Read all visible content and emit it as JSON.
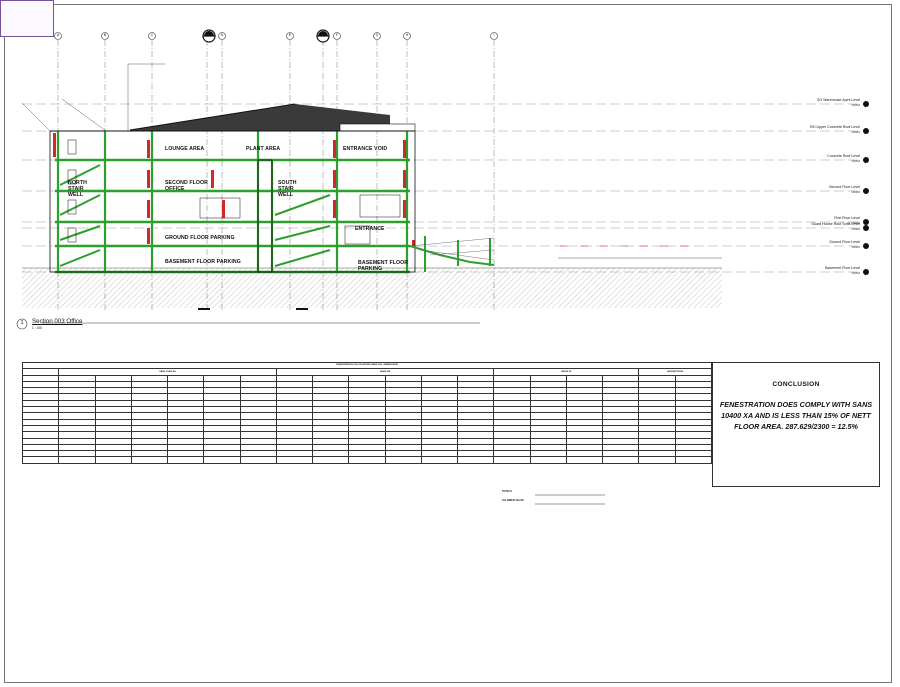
{
  "stamp": {
    "lines": [
      "",
      "",
      "",
      "",
      "",
      ""
    ]
  },
  "gridlines": [
    "A",
    "B",
    "C",
    "D",
    "E",
    "F",
    "G",
    "H",
    "I",
    "J"
  ],
  "levels": [
    {
      "label": "SO Warehouse Apex Level",
      "rl": "00000"
    },
    {
      "label": "SSI Upper Concrete Roof Level",
      "rl": "00000"
    },
    {
      "label": "Concrete Roof Level",
      "rl": "00000"
    },
    {
      "label": "Second Floor Level",
      "rl": "00000"
    },
    {
      "label": "First Floor Level",
      "rl": "00000"
    },
    {
      "label": "Guard House Roof Soffit Level",
      "rl": "00000"
    },
    {
      "label": "Ground Floor Level",
      "rl": "00000"
    },
    {
      "label": "Basement Floor Level",
      "rl": "00000"
    }
  ],
  "rooms": {
    "lounge": "LOUNGE AREA",
    "plant": "PLANT AREA",
    "entrance_void": "ENTRANCE VOID",
    "north_stair": "NORTH\nSTAIR\nWELL",
    "second_office": "SECOND FLOOR\nOFFICE",
    "south_stair": "SOUTH\nSTAIR\nWELL",
    "entrance": "ENTRANCE",
    "ground_parking": "GROUND FLOOR PARKING",
    "basement_parking_left": "BASEMENT FLOOR PARKING",
    "basement_parking_right": "BASEMENT FLOOR\nPARKING"
  },
  "section": {
    "number": "1",
    "title": "Section 003 Office",
    "scale": "1 : 100"
  },
  "table": {
    "title": "FENESTRATION CALCULATIONS SANS 204 - WAREHOUSE",
    "group_headers": [
      "SANS 10400 XA",
      "SANS 204",
      "RESULTS",
      "ASSUMPTIONS"
    ],
    "totals_label": "TOTALS",
    "allowed_label": "ALLOWED VALUE"
  },
  "conclusion": {
    "title": "CONCLUSION",
    "text": "FENESTRATION DOES COMPLY WITH SANS 10400 XA AND IS LESS THAN 15% OF NETT FLOOR AREA.  287.629/2300 = 12.5%"
  },
  "colors": {
    "structure_green": "#2ca02c",
    "section_red": "#d62728",
    "roof_dark": "#3a3a3a",
    "hatch": "#9a9a9a"
  }
}
